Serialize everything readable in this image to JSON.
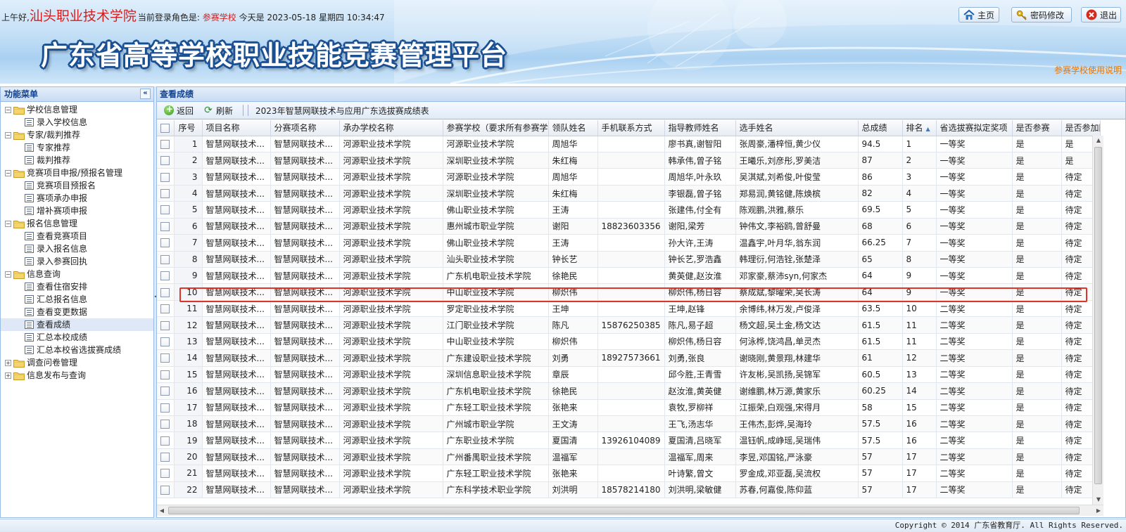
{
  "header": {
    "greeting": "上午好,",
    "school": "汕头职业技术学院",
    "role_label": "当前登录角色是:",
    "role": "参赛学校",
    "date_label": "今天是",
    "datetime": "2023-05-18 星期四 10:34:47",
    "platform_title": "广东省高等学校职业技能竞赛管理平台",
    "home_label": "主页",
    "password_label": "密码修改",
    "exit_label": "退出",
    "manual_link": "参赛学校使用说明"
  },
  "menu": {
    "title": "功能菜单",
    "collapse_icon": "«",
    "groups": [
      {
        "label": "学校信息管理",
        "expanded": true,
        "items": [
          "录入学校信息"
        ]
      },
      {
        "label": "专家/裁判推荐",
        "expanded": true,
        "items": [
          "专家推荐",
          "裁判推荐"
        ]
      },
      {
        "label": "竞赛项目申报/预报名管理",
        "expanded": true,
        "items": [
          "竞赛项目预报名",
          "赛项承办申报",
          "增补赛项申报"
        ]
      },
      {
        "label": "报名信息管理",
        "expanded": true,
        "items": [
          "查看竞赛项目",
          "录入报名信息",
          "录入参赛回执"
        ]
      },
      {
        "label": "信息查询",
        "expanded": true,
        "items": [
          "查看住宿安排",
          "汇总报名信息",
          "查看变更数据",
          "查看成绩",
          "汇总本校成绩",
          "汇总本校省选拔赛成绩"
        ]
      },
      {
        "label": "调查问卷管理",
        "expanded": false,
        "items": []
      },
      {
        "label": "信息发布与查询",
        "expanded": false,
        "items": []
      }
    ],
    "selected_item": "查看成绩"
  },
  "panel": {
    "title": "查看成绩",
    "back_label": "返回",
    "refresh_label": "刷新",
    "toolbar_title": "2023年智慧网联技术与应用广东选拔赛成绩表"
  },
  "table": {
    "columns": [
      "序号",
      "项目名称",
      "分赛项名称",
      "承办学校名称",
      "参赛学校（要求所有参赛学",
      "领队姓名",
      "手机联系方式",
      "指导教师姓名",
      "选手姓名",
      "总成绩",
      "排名",
      "省选拔赛拟定奖项",
      "是否参赛",
      "是否参加国"
    ],
    "sorted_column": "排名",
    "rows": [
      [
        "1",
        "智慧网联技术...",
        "智慧网联技术...",
        "河源职业技术学院",
        "河源职业技术学院",
        "周旭华",
        "",
        "廖书真,谢智阳",
        "张周豪,潘梓恒,黄少仪",
        "94.5",
        "1",
        "一等奖",
        "是",
        "是"
      ],
      [
        "2",
        "智慧网联技术...",
        "智慧网联技术...",
        "河源职业技术学院",
        "深圳职业技术学院",
        "朱红梅",
        "",
        "韩承伟,曾子铭",
        "王曦乐,刘彦彤,罗美洁",
        "87",
        "2",
        "一等奖",
        "是",
        "是"
      ],
      [
        "3",
        "智慧网联技术...",
        "智慧网联技术...",
        "河源职业技术学院",
        "河源职业技术学院",
        "周旭华",
        "",
        "周旭华,叶永玖",
        "吴淇斌,刘希俊,叶俊莹",
        "86",
        "3",
        "一等奖",
        "是",
        "待定"
      ],
      [
        "4",
        "智慧网联技术...",
        "智慧网联技术...",
        "河源职业技术学院",
        "深圳职业技术学院",
        "朱红梅",
        "",
        "李银磊,曾子铭",
        "郑易润,黄铭健,陈焕槟",
        "82",
        "4",
        "一等奖",
        "是",
        "待定"
      ],
      [
        "5",
        "智慧网联技术...",
        "智慧网联技术...",
        "河源职业技术学院",
        "佛山职业技术学院",
        "王涛",
        "",
        "张建伟,付全有",
        "陈观鹏,洪雅,蔡乐",
        "69.5",
        "5",
        "一等奖",
        "是",
        "待定"
      ],
      [
        "6",
        "智慧网联技术...",
        "智慧网联技术...",
        "河源职业技术学院",
        "惠州城市职业学院",
        "谢阳",
        "18823603356",
        "谢阳,梁芳",
        "钟伟文,李裕鸥,曾舒曼",
        "68",
        "6",
        "一等奖",
        "是",
        "待定"
      ],
      [
        "7",
        "智慧网联技术...",
        "智慧网联技术...",
        "河源职业技术学院",
        "佛山职业技术学院",
        "王涛",
        "",
        "孙大许,王涛",
        "温鑫宇,叶月华,翁东润",
        "66.25",
        "7",
        "一等奖",
        "是",
        "待定"
      ],
      [
        "8",
        "智慧网联技术...",
        "智慧网联技术...",
        "河源职业技术学院",
        "汕头职业技术学院",
        "钟长艺",
        "",
        "钟长艺,罗浩鑫",
        "韩理衍,何浩铨,张楚泽",
        "65",
        "8",
        "一等奖",
        "是",
        "待定"
      ],
      [
        "9",
        "智慧网联技术...",
        "智慧网联技术...",
        "河源职业技术学院",
        "广东机电职业技术学院",
        "徐艳民",
        "",
        "黄英健,赵汝淮",
        "邓家豪,蔡沛syn,何家杰",
        "64",
        "9",
        "一等奖",
        "是",
        "待定"
      ],
      [
        "10",
        "智慧网联技术...",
        "智慧网联技术...",
        "河源职业技术学院",
        "中山职业技术学院",
        "柳炽伟",
        "",
        "柳炽伟,杨日容",
        "蔡成斌,黎曜荣,吴长涛",
        "64",
        "9",
        "一等奖",
        "是",
        "待定"
      ],
      [
        "11",
        "智慧网联技术...",
        "智慧网联技术...",
        "河源职业技术学院",
        "罗定职业技术学院",
        "王坤",
        "",
        "王坤,赵锋",
        "余博纬,林万发,卢俊泽",
        "63.5",
        "10",
        "二等奖",
        "是",
        "待定"
      ],
      [
        "12",
        "智慧网联技术...",
        "智慧网联技术...",
        "河源职业技术学院",
        "江门职业技术学院",
        "陈凡",
        "15876250385",
        "陈凡,易子超",
        "杨文超,吴土金,杨文达",
        "61.5",
        "11",
        "二等奖",
        "是",
        "待定"
      ],
      [
        "13",
        "智慧网联技术...",
        "智慧网联技术...",
        "河源职业技术学院",
        "中山职业技术学院",
        "柳炽伟",
        "",
        "柳炽伟,杨日容",
        "何泳桦,饶鸿昌,单灵杰",
        "61.5",
        "11",
        "二等奖",
        "是",
        "待定"
      ],
      [
        "14",
        "智慧网联技术...",
        "智慧网联技术...",
        "河源职业技术学院",
        "广东建设职业技术学院",
        "刘勇",
        "18927573661",
        "刘勇,张良",
        "谢晓刚,黄景翔,林建华",
        "61",
        "12",
        "二等奖",
        "是",
        "待定"
      ],
      [
        "15",
        "智慧网联技术...",
        "智慧网联技术...",
        "河源职业技术学院",
        "深圳信息职业技术学院",
        "章辰",
        "",
        "邱今胜,王青雪",
        "许友彬,吴凯扬,吴锦军",
        "60.5",
        "13",
        "二等奖",
        "是",
        "待定"
      ],
      [
        "16",
        "智慧网联技术...",
        "智慧网联技术...",
        "河源职业技术学院",
        "广东机电职业技术学院",
        "徐艳民",
        "",
        "赵汝淮,黄英健",
        "谢维鹏,林万源,黄家乐",
        "60.25",
        "14",
        "二等奖",
        "是",
        "待定"
      ],
      [
        "17",
        "智慧网联技术...",
        "智慧网联技术...",
        "河源职业技术学院",
        "广东轻工职业技术学院",
        "张艳来",
        "",
        "袁牧,罗柳祥",
        "江振荣,白观强,宋得月",
        "58",
        "15",
        "二等奖",
        "是",
        "待定"
      ],
      [
        "18",
        "智慧网联技术...",
        "智慧网联技术...",
        "河源职业技术学院",
        "广州城市职业学院",
        "王文涛",
        "",
        "王飞,汤志华",
        "王伟杰,彭烨,吴海玲",
        "57.5",
        "16",
        "二等奖",
        "是",
        "待定"
      ],
      [
        "19",
        "智慧网联技术...",
        "智慧网联技术...",
        "河源职业技术学院",
        "广东职业技术学院",
        "夏国清",
        "13926104089",
        "夏国清,吕晓军",
        "温钰帆,成峥瑶,吴瑞伟",
        "57.5",
        "16",
        "二等奖",
        "是",
        "待定"
      ],
      [
        "20",
        "智慧网联技术...",
        "智慧网联技术...",
        "河源职业技术学院",
        "广州番禺职业技术学院",
        "温福军",
        "",
        "温福军,周来",
        "李昱,邓国铭,严泳豪",
        "57",
        "17",
        "二等奖",
        "是",
        "待定"
      ],
      [
        "21",
        "智慧网联技术...",
        "智慧网联技术...",
        "河源职业技术学院",
        "广东轻工职业技术学院",
        "张艳来",
        "",
        "叶诗繁,曾文",
        "罗金成,邓亚磊,吴流权",
        "57",
        "17",
        "二等奖",
        "是",
        "待定"
      ],
      [
        "22",
        "智慧网联技术...",
        "智慧网联技术...",
        "河源职业技术学院",
        "广东科学技术职业学院",
        "刘洪明",
        "18578214180",
        "刘洪明,梁敏健",
        "苏春,何嘉俊,陈仰蓝",
        "57",
        "17",
        "二等奖",
        "是",
        "待定"
      ]
    ]
  },
  "footer": {
    "copyright": "Copyright © 2014 广东省教育厅. All Rights Reserved."
  },
  "colors": {
    "accent": "#15428b",
    "highlight": "#e0342a",
    "school_red": "#d21f1f",
    "link_orange": "#e0770c"
  }
}
